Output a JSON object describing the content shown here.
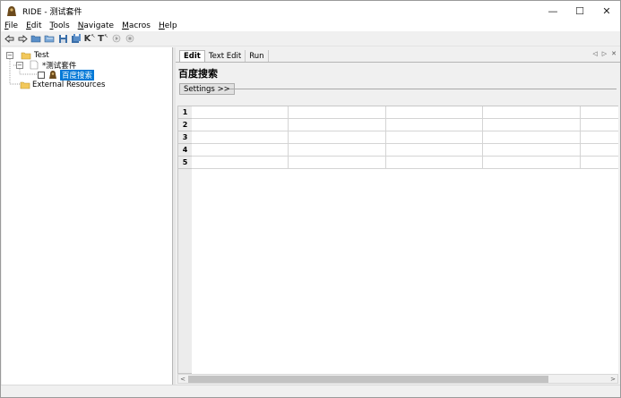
{
  "window": {
    "title": "RIDE - 测试套件",
    "minimize": "—",
    "maximize": "☐",
    "close": "✕"
  },
  "menu": [
    {
      "label": "File",
      "underline": "F",
      "rest": "ile"
    },
    {
      "label": "Edit",
      "underline": "E",
      "rest": "dit"
    },
    {
      "label": "Tools",
      "underline": "T",
      "rest": "ools"
    },
    {
      "label": "Navigate",
      "underline": "N",
      "rest": "avigate"
    },
    {
      "label": "Macros",
      "underline": "M",
      "rest": "acros"
    },
    {
      "label": "Help",
      "underline": "H",
      "rest": "elp"
    }
  ],
  "toolbar": {
    "icons": [
      "back-arrow-icon",
      "forward-arrow-icon",
      "open-folder-icon",
      "open-directory-icon",
      "save-icon",
      "save-all-icon",
      "search-keywords-icon",
      "search-tests-icon",
      "run-icon",
      "stop-icon"
    ],
    "k_label": "K",
    "t_label": "T"
  },
  "tree": {
    "root": "Test",
    "suite": "*测试套件",
    "testcase": "百度搜索",
    "external": "External Resources",
    "expand_minus": "−"
  },
  "tabs": [
    {
      "label": "Edit",
      "active": true
    },
    {
      "label": "Text Edit",
      "active": false
    },
    {
      "label": "Run",
      "active": false
    }
  ],
  "editor": {
    "title": "百度搜索",
    "settings_label": "Settings >>",
    "row_numbers": [
      "1",
      "2",
      "3",
      "4",
      "5"
    ]
  },
  "colors": {
    "selection": "#0078d7",
    "grid_header": "#ececec"
  }
}
